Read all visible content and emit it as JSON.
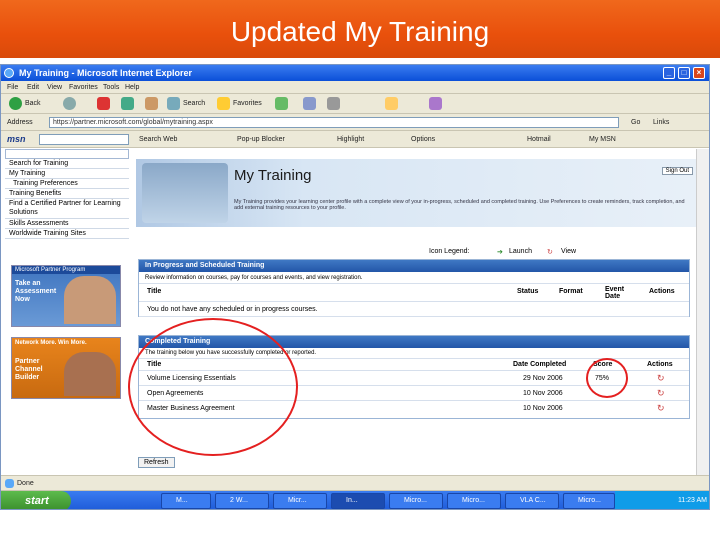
{
  "slide_title": "Updated My Training",
  "window": {
    "title": "My Training - Microsoft Internet Explorer"
  },
  "menu": [
    "File",
    "Edit",
    "View",
    "Favorites",
    "Tools",
    "Help"
  ],
  "toolbar": {
    "back": "Back",
    "search": "Search",
    "favorites": "Favorites"
  },
  "address": {
    "label": "Address",
    "value": "https://partner.microsoft.com/global/mytraining.aspx"
  },
  "links_bar": {
    "logo": "msn",
    "items": [
      "Search Web",
      "Pop-up Blocker",
      "Highlight",
      "Options",
      "Hotmail",
      "My MSN"
    ]
  },
  "sidebar": {
    "items": [
      "Search for Training",
      "My Training",
      "Training Preferences",
      "Training Benefits",
      "Find a Certified Partner for Learning Solutions",
      "Skills Assessments",
      "Worldwide Training Sites"
    ],
    "ad1": {
      "brand": "Microsoft Partner Program",
      "text": "Take an Assessment Now"
    },
    "ad2": {
      "head": "Network More. Win More.",
      "text": "Partner Channel Builder"
    }
  },
  "banner": {
    "title": "My Training",
    "signout": "Sign Out",
    "desc": "My Training provides your learning center profile with a complete view of your in-progress, scheduled and completed training. Use Preferences to create reminders, track completion, and add external training resources to your profile."
  },
  "legend": {
    "label": "Icon Legend:",
    "launch": "Launch",
    "view": "View"
  },
  "in_progress": {
    "title": "In Progress and Scheduled Training",
    "note": "Review information on courses, pay for courses and events, and view registration.",
    "columns": [
      "Title",
      "Status",
      "Format",
      "Event Date",
      "Actions"
    ],
    "empty": "You do not have any scheduled or in progress courses."
  },
  "completed": {
    "title": "Completed Training",
    "note": "The training below you have successfully completed or reported.",
    "columns": [
      "Title",
      "Date Completed",
      "Score",
      "Actions"
    ],
    "rows": [
      {
        "title": "Volume Licensing Essentials",
        "date": "29 Nov 2006",
        "score": "75%"
      },
      {
        "title": "Open Agreements",
        "date": "10 Nov 2006",
        "score": ""
      },
      {
        "title": "Master Business Agreement",
        "date": "10 Nov 2006",
        "score": ""
      }
    ]
  },
  "refresh": "Refresh",
  "status": "Done",
  "taskbar": {
    "start": "start",
    "tasks": [
      "M...",
      "2 W...",
      "Micr...",
      "...",
      "In...",
      "Micro...",
      "Micro...",
      "VLA C...",
      "Micro..."
    ],
    "clock": "11:23 AM"
  },
  "colors": {
    "header": "#e9500c",
    "highlight_circle": "#e42020",
    "section_header": "#2356a8"
  }
}
